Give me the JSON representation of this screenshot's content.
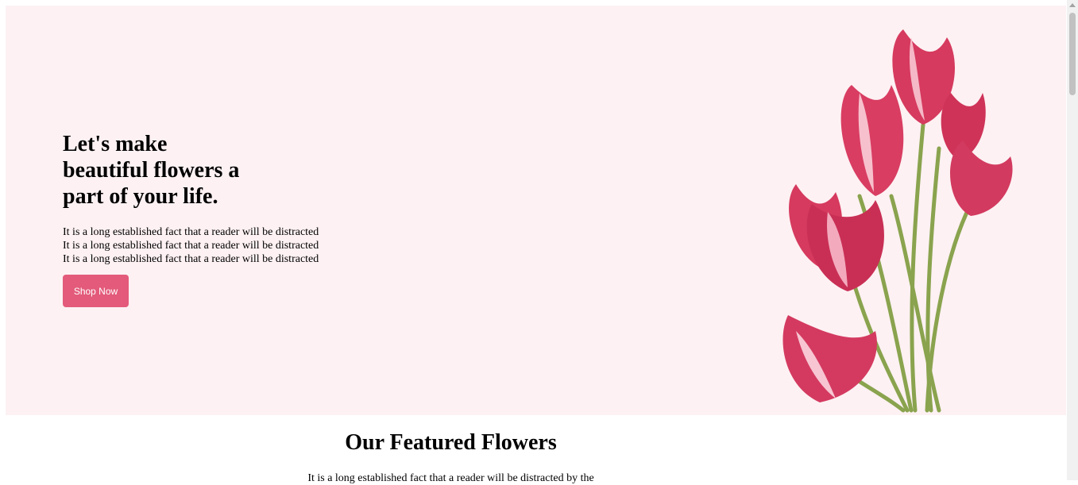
{
  "hero": {
    "title": "Let's make beautiful flowers a part of your life.",
    "lines": [
      "It is a long established fact that a reader will be distracted",
      "It is a long established fact that a reader will be distracted",
      "It is a long established fact that a reader will be distracted"
    ],
    "cta_label": "Shop Now",
    "image_icon": "tulip-bouquet-image"
  },
  "featured": {
    "title": "Our Featured Flowers",
    "description": "It is a long established fact that a reader will be distracted by the"
  },
  "colors": {
    "hero_background": "#fdf1f3",
    "accent": "#e35a7a",
    "petal": "#d63a5e",
    "stem": "#8aa34e"
  }
}
